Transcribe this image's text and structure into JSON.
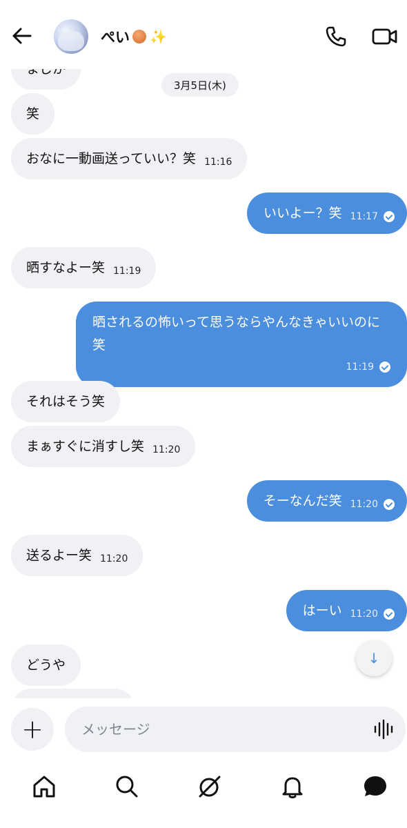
{
  "header": {
    "contact_name": "ぺい",
    "icons": {
      "back": "arrow-left-icon",
      "call": "phone-icon",
      "video": "video-camera-icon",
      "avatar": "profile-avatar"
    }
  },
  "date_divider": "3月5日(木)",
  "messages": [
    {
      "side": "in",
      "text": "まじか",
      "time": ""
    },
    {
      "side": "in",
      "text": "笑",
      "time": ""
    },
    {
      "side": "in",
      "text": "おなに一動画送っていい？笑",
      "time": "11:16"
    },
    {
      "side": "out",
      "text": "いいよー？笑",
      "time": "11:17",
      "read": true
    },
    {
      "side": "in",
      "text": "晒すなよー笑",
      "time": "11:19"
    },
    {
      "side": "out",
      "text": "晒されるの怖いって思うならやんなきゃいいのに笑",
      "time": "11:19",
      "read": true
    },
    {
      "side": "in",
      "text": "それはそう笑",
      "time": ""
    },
    {
      "side": "in",
      "text": "まぁすぐに消すし笑",
      "time": "11:20"
    },
    {
      "side": "out",
      "text": "そーなんだ笑",
      "time": "11:20",
      "read": true
    },
    {
      "side": "in",
      "text": "送るよー笑",
      "time": "11:20"
    },
    {
      "side": "out",
      "text": "はーい",
      "time": "11:20",
      "read": true
    },
    {
      "side": "in",
      "text": "どうや",
      "time": ""
    }
  ],
  "composer": {
    "placeholder": "メッセージ",
    "plus_label": "+",
    "icons": {
      "voice": "voice-waveform-icon"
    }
  },
  "scroll_down_label": "↓",
  "tabbar": {
    "items": [
      "home-icon",
      "search-icon",
      "grok-icon",
      "notifications-bell-icon",
      "messages-icon"
    ],
    "active": "messages-icon"
  },
  "colors": {
    "outgoing_bubble": "#4a8edd",
    "incoming_bubble": "#eff1f4",
    "background": "#ffffff"
  }
}
